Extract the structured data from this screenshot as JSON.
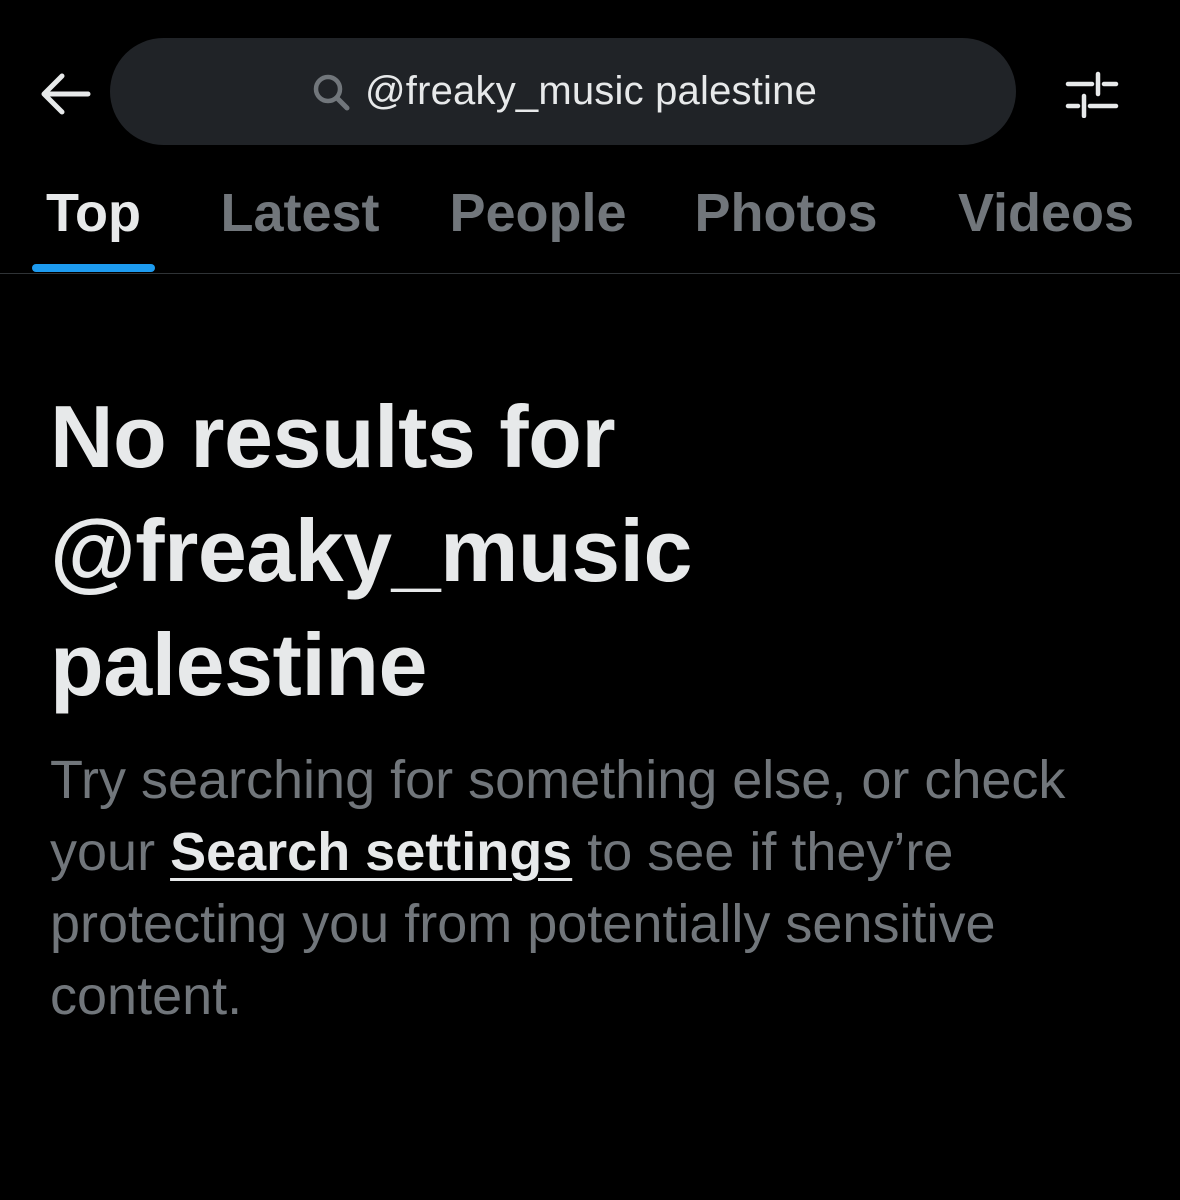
{
  "search": {
    "query": "@freaky_music palestine"
  },
  "tabs": [
    {
      "label": "Top",
      "active": true
    },
    {
      "label": "Latest",
      "active": false
    },
    {
      "label": "People",
      "active": false
    },
    {
      "label": "Photos",
      "active": false
    },
    {
      "label": "Videos",
      "active": false
    }
  ],
  "empty_state": {
    "title_line_1": "No results for",
    "title_line_2": "@freaky_music",
    "title_line_3": "palestine",
    "body_before_link": "Try searching for something else, or check your ",
    "link_label": "Search settings",
    "body_after_link": " to see if they’re protecting you from potentially sensitive content."
  },
  "icons": {
    "back": "arrow-left-icon",
    "search": "search-icon",
    "filter": "sliders-icon"
  },
  "colors": {
    "background": "#000000",
    "search_pill": "#202327",
    "primary_text": "#e7e9ea",
    "secondary_text": "#71767b",
    "accent": "#1d9bf0",
    "divider": "#2f3336"
  }
}
